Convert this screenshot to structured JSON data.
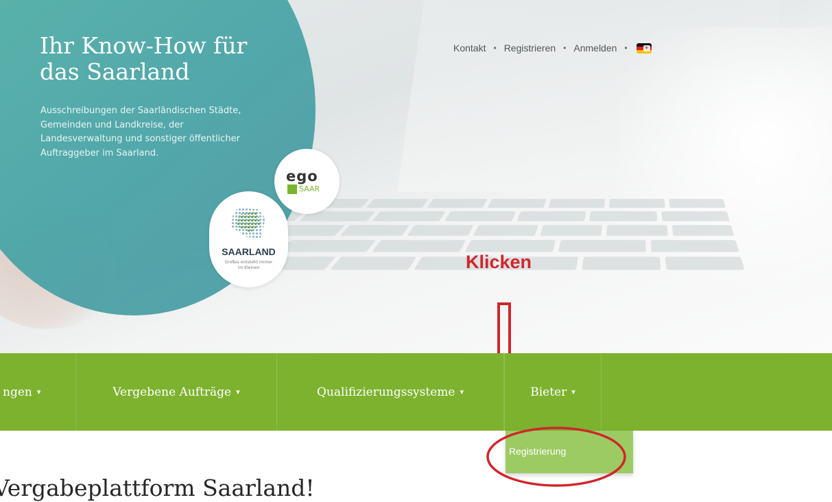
{
  "hero": {
    "title": "Ihr Know-How für das Saarland",
    "text": "Ausschreibungen der Saarländischen Städte, Gemeinden und Landkreise, der Landesverwaltung und sonstiger öffentlicher Auftraggeber im Saarland.",
    "ego_logo": {
      "mark": "ego",
      "name": "SAAR"
    },
    "saarland_logo": {
      "name": "SAARLAND",
      "slogan": "Großes entsteht immer im Kleinen"
    }
  },
  "top_nav": {
    "items": [
      "Kontakt",
      "Registrieren",
      "Anmelden"
    ],
    "separator": "•",
    "language_icon": "german-flag-icon"
  },
  "annotation": {
    "label": "Klicken",
    "color": "#d0262b"
  },
  "main_nav": {
    "items": [
      {
        "label": "ngen"
      },
      {
        "label": "Vergebene Aufträge"
      },
      {
        "label": "Qualifizierungssysteme"
      },
      {
        "label": "Bieter"
      }
    ],
    "caret": "▾",
    "background": "#7db22f"
  },
  "dropdown": {
    "items": [
      "Registrierung"
    ]
  },
  "page": {
    "title": "Vergabeplattform Saarland!"
  },
  "colors": {
    "accent": "#7db22f",
    "hero_circle": "#4fa9a6",
    "dropdown": "#9ccb63"
  }
}
